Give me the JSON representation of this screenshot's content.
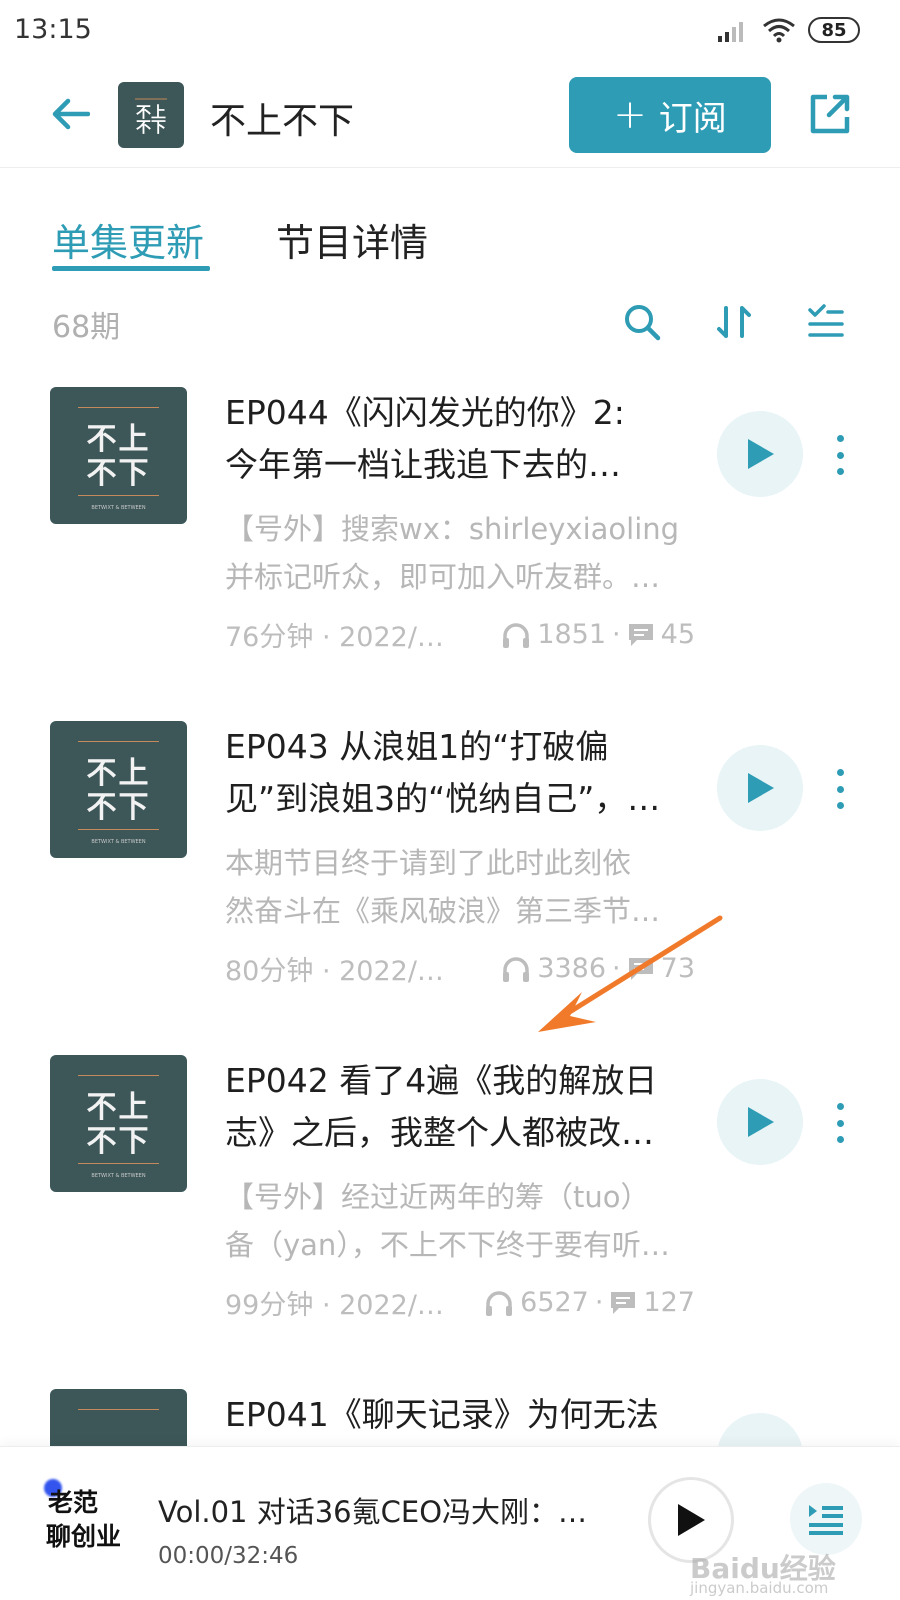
{
  "status_bar": {
    "time": "13:15",
    "battery": "85"
  },
  "header": {
    "title": "不上不下",
    "subscribe_label": "订阅"
  },
  "tabs": [
    {
      "label": "单集更新",
      "active": true
    },
    {
      "label": "节目详情",
      "active": false
    }
  ],
  "toolbar": {
    "count": "68期"
  },
  "episodes": [
    {
      "title_line1": "EP044《闪闪发光的你》2:",
      "title_line2": "今年第一档让我追下去的…",
      "desc_line1": "【号外】搜索wx：shirleyxiaoling",
      "desc_line2": "并标记听众，即可加入听友群。…",
      "duration_date": "76分钟 · 2022/0…",
      "plays": "1851",
      "comments": "45"
    },
    {
      "title_line1": "EP043 从浪姐1的“打破偏",
      "title_line2": "见”到浪姐3的“悦纳自己”，…",
      "desc_line1": "本期节目终于请到了此时此刻依",
      "desc_line2": "然奋斗在《乘风破浪》第三季节…",
      "duration_date": "80分钟 · 2022/0…",
      "plays": "3386",
      "comments": "73"
    },
    {
      "title_line1": "EP042 看了4遍《我的解放日",
      "title_line2": "志》之后，我整个人都被改…",
      "desc_line1": "【号外】经过近两年的筹（tuo）",
      "desc_line2": "备（yan），不上不下终于要有听…",
      "duration_date": "99分钟 · 2022/…",
      "plays": "6527",
      "comments": "127"
    },
    {
      "title_line1": "EP041《聊天记录》为何无法",
      "title_line2": "",
      "desc_line1": "",
      "desc_line2": "",
      "duration_date": "",
      "plays": "",
      "comments": ""
    }
  ],
  "cover": {
    "glyph_top": "不上",
    "glyph_bottom": "不下",
    "caption": "BETWIXT & BETWEEN"
  },
  "mini_player": {
    "logo_line1": "老范",
    "logo_line2": "聊创业",
    "title": "Vol.01 对话36氪CEO冯大刚：…",
    "time": "00:00/32:46"
  },
  "watermark": {
    "text": "Baidu经验",
    "url": "jingyan.baidu.com"
  },
  "colors": {
    "accent": "#2e9cb5",
    "cover_bg": "#3d5759",
    "annotation_arrow": "#f07a2a"
  }
}
